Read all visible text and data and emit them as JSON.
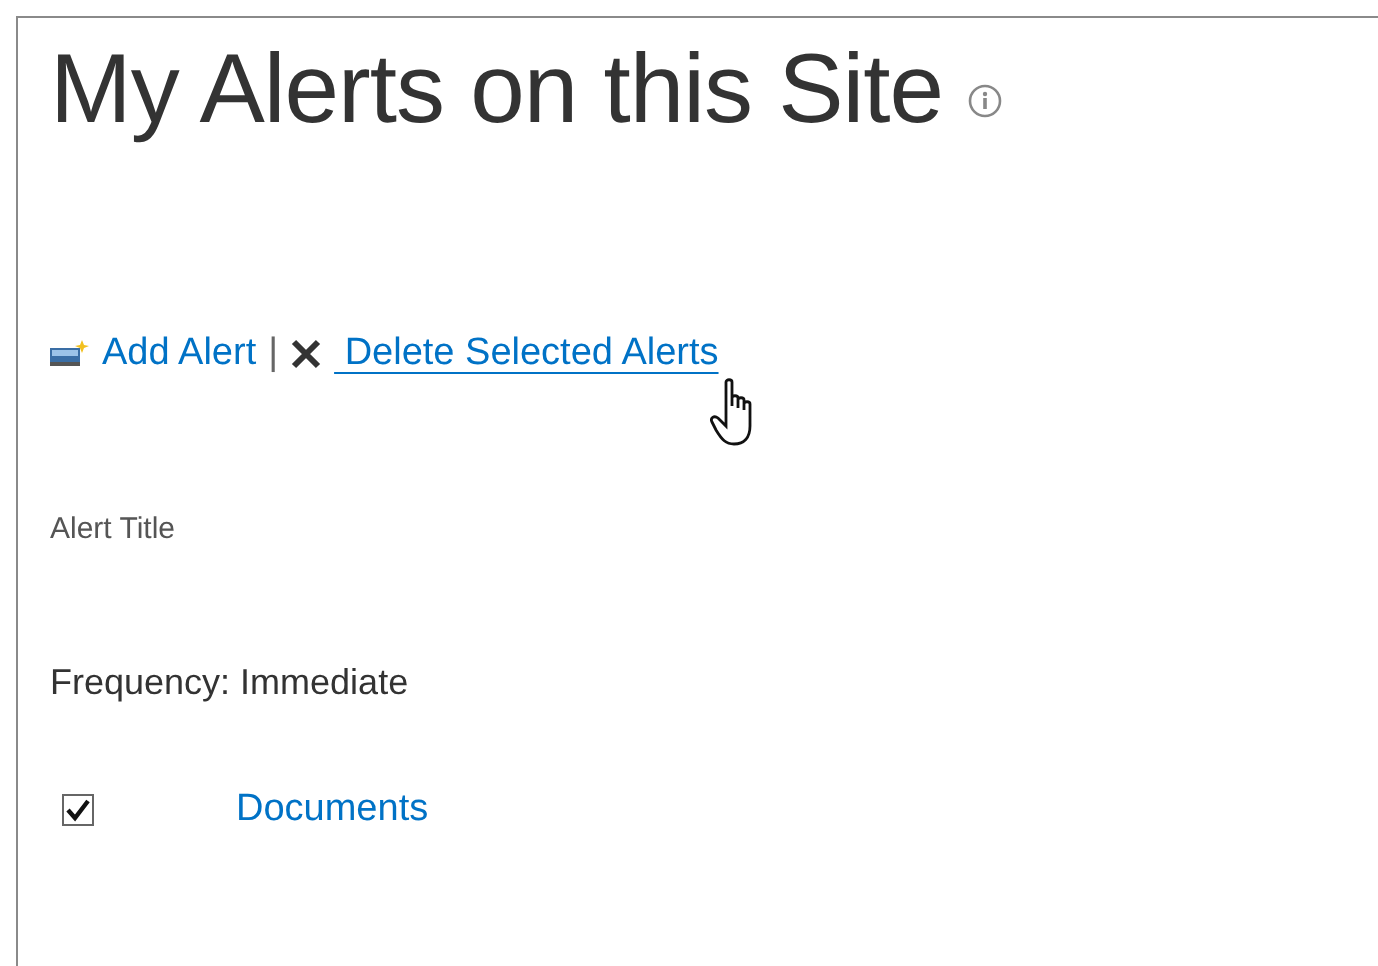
{
  "page": {
    "title": "My Alerts on this Site"
  },
  "toolbar": [
    {
      "kind": "add",
      "label": "Add Alert",
      "hovered": false
    },
    {
      "kind": "delete",
      "label": " Delete Selected Alerts",
      "hovered": true
    }
  ],
  "toolbar_separator": "|",
  "list": {
    "column_header": "Alert Title",
    "group_header": "Frequency: Immediate",
    "items": [
      {
        "label": "Documents",
        "checked": true
      }
    ]
  }
}
